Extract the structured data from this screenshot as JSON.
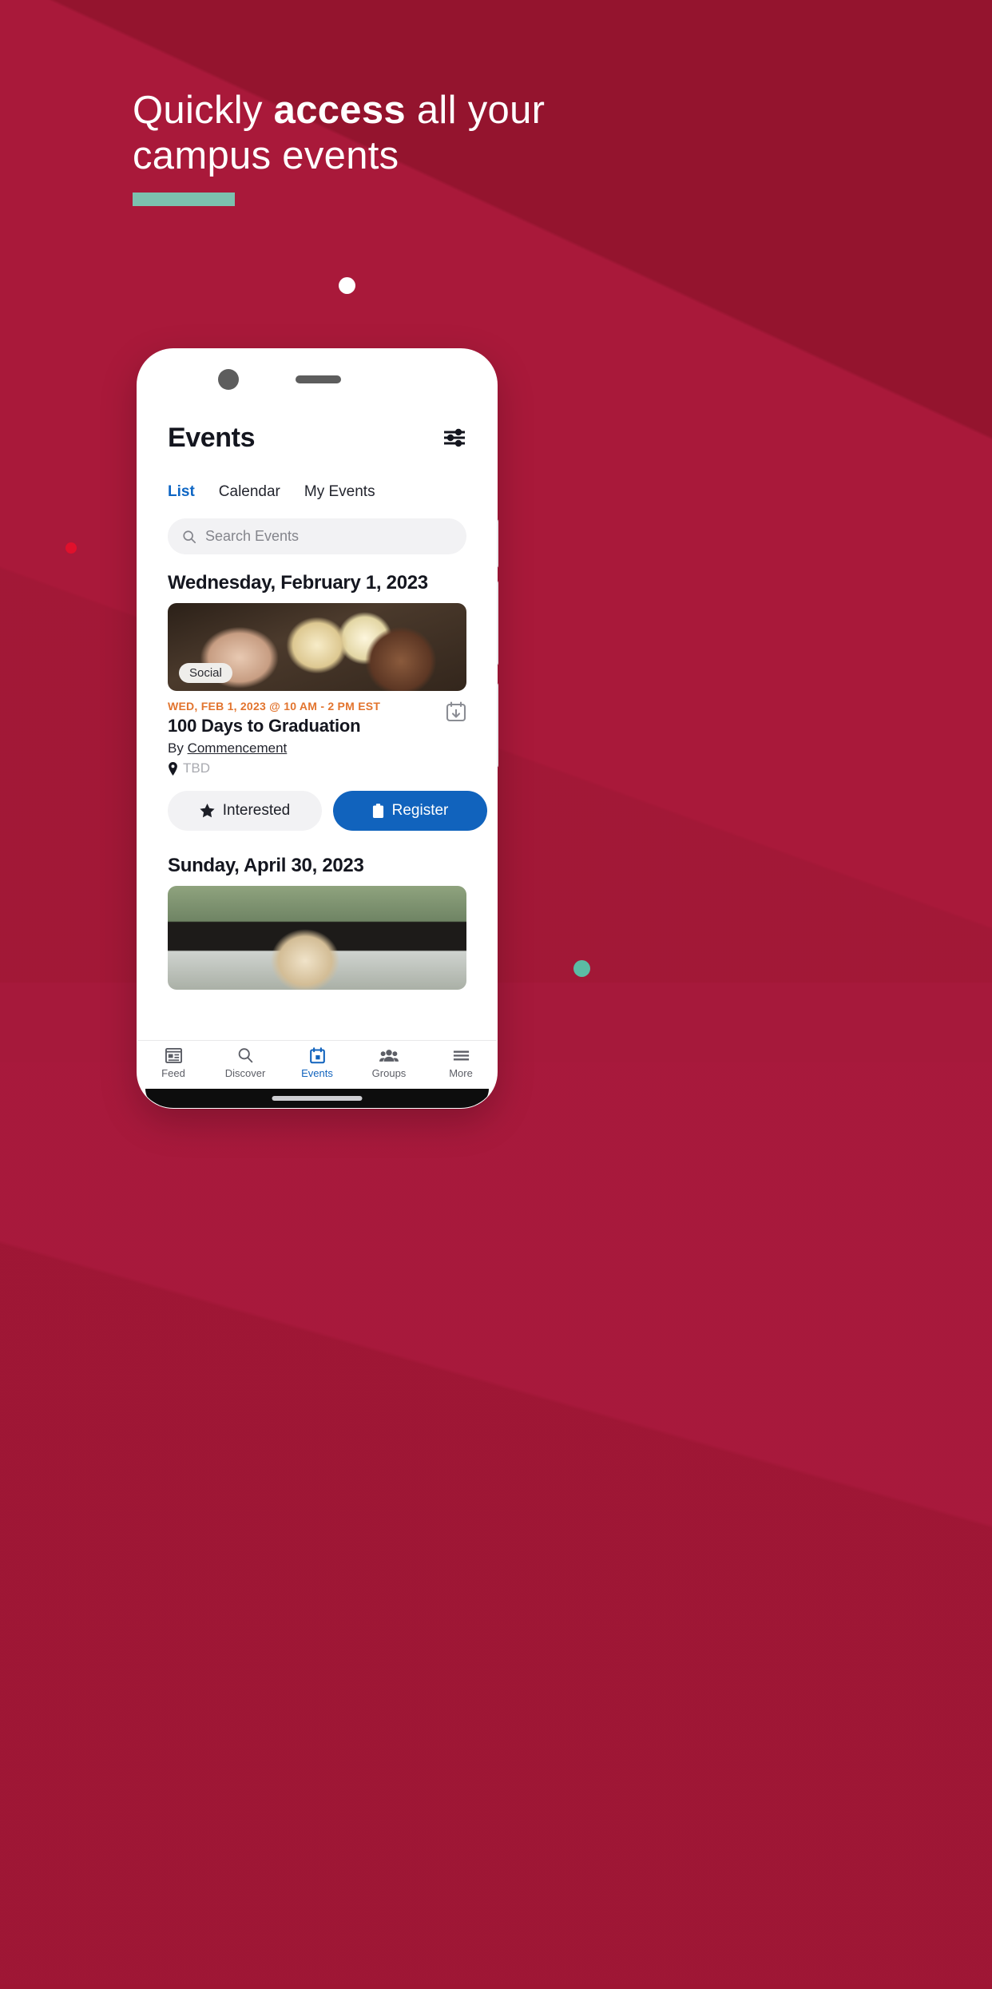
{
  "promo": {
    "headline_part1": "Quickly ",
    "headline_bold": "access",
    "headline_part2": " all your campus events",
    "accent_color": "#7cc0ae",
    "background_color": "#a9193a"
  },
  "phone": {
    "app": {
      "header": {
        "title": "Events",
        "filter_icon": "sliders-filter-icon"
      },
      "tabs": [
        {
          "label": "List",
          "active": true
        },
        {
          "label": "Calendar",
          "active": false
        },
        {
          "label": "My Events",
          "active": false
        }
      ],
      "search": {
        "placeholder": "Search Events",
        "icon": "search-icon"
      },
      "sections": [
        {
          "date_heading": "Wednesday, February 1, 2023",
          "event": {
            "badge": "Social",
            "time": "WED, FEB 1, 2023 @ 10 AM - 2 PM EST",
            "title": "100 Days to Graduation",
            "by_prefix": "By ",
            "by_org": "Commencement",
            "location": "TBD",
            "add_to_calendar_icon": "calendar-download-icon",
            "actions": {
              "interested_label": "Interested",
              "interested_icon": "star-icon",
              "register_label": "Register",
              "register_icon": "clipboard-icon"
            }
          }
        },
        {
          "date_heading": "Sunday, April 30, 2023",
          "event": {
            "badge": "",
            "time": "",
            "title": "",
            "by_prefix": "",
            "by_org": "",
            "location": "",
            "add_to_calendar_icon": "",
            "actions": {
              "interested_label": "",
              "register_label": ""
            }
          }
        }
      ],
      "bottom_nav": [
        {
          "label": "Feed",
          "icon": "feed-icon",
          "active": false
        },
        {
          "label": "Discover",
          "icon": "search-icon",
          "active": false
        },
        {
          "label": "Events",
          "icon": "calendar-icon",
          "active": true
        },
        {
          "label": "Groups",
          "icon": "people-icon",
          "active": false
        },
        {
          "label": "More",
          "icon": "hamburger-icon",
          "active": false
        }
      ]
    }
  },
  "colors": {
    "accent_blue": "#1163bd",
    "accent_orange": "#e2742e",
    "teal": "#7cc0ae",
    "brand_red": "#a9193a"
  }
}
